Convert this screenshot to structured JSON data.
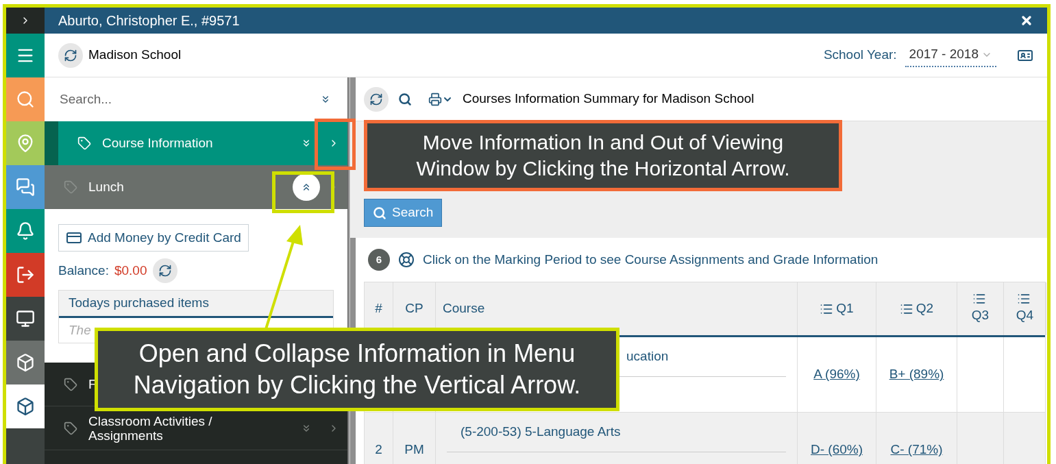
{
  "window": {
    "title": "Aburto, Christopher E., #9571"
  },
  "school": {
    "name": "Madison School",
    "year_label": "School Year:",
    "year_value": "2017 - 2018"
  },
  "rail": [
    {
      "kind": "menu",
      "color": "#00937e",
      "selected": false
    },
    {
      "kind": "search",
      "color": "#f69a55",
      "selected": false
    },
    {
      "kind": "pin",
      "color": "#a3c95a",
      "selected": false
    },
    {
      "kind": "chat",
      "color": "#4f99d2",
      "selected": false
    },
    {
      "kind": "bell",
      "color": "#00937e",
      "selected": false
    },
    {
      "kind": "exit",
      "color": "#d23b27",
      "selected": false
    },
    {
      "kind": "monitor",
      "color": "#3c4240",
      "selected": false
    },
    {
      "kind": "cube",
      "color": "#6b706d",
      "selected": false
    },
    {
      "kind": "cube",
      "color": "#ffffff",
      "selected": true
    }
  ],
  "nav": {
    "search_placeholder": "Search...",
    "items": [
      {
        "label": "Course Information",
        "selected": true,
        "expanded": false
      },
      {
        "label": "Lunch",
        "selected": false,
        "expanded": true
      },
      {
        "label": "F",
        "selected": false,
        "expanded": false
      },
      {
        "label": "Classroom Activities / Assignments",
        "selected": false,
        "expanded": false
      }
    ],
    "lunch": {
      "add_money": "Add Money by Credit Card",
      "balance_label": "Balance:",
      "balance_value": "$0.00",
      "purchased_header": "Todays purchased items",
      "purchased_empty": "The"
    }
  },
  "main": {
    "title": "Courses Information Summary for Madison School",
    "search_button": "Search",
    "count": "6",
    "hint": "Click on the Marking Period to see Course Assignments and Grade Information",
    "columns": [
      "#",
      "CP",
      "Course",
      "Q1",
      "Q2",
      "Q3",
      "Q4"
    ],
    "rows": [
      {
        "num": "",
        "cp": "",
        "course": "ucation",
        "q1": "A (96%)",
        "q2": "B+ (89%)"
      },
      {
        "num": "2",
        "cp": "PM",
        "course": "(5-200-53) 5-Language Arts",
        "q1": "D- (60%)",
        "q2": "C- (71%)"
      }
    ]
  },
  "callouts": [
    {
      "text": "Move Information In and Out of Viewing Window by Clicking the Horizontal Arrow.",
      "color": "#f26b38"
    },
    {
      "text": "Open and Collapse Information in Menu Navigation by Clicking the Vertical Arrow.",
      "color": "#cfdf00"
    }
  ]
}
